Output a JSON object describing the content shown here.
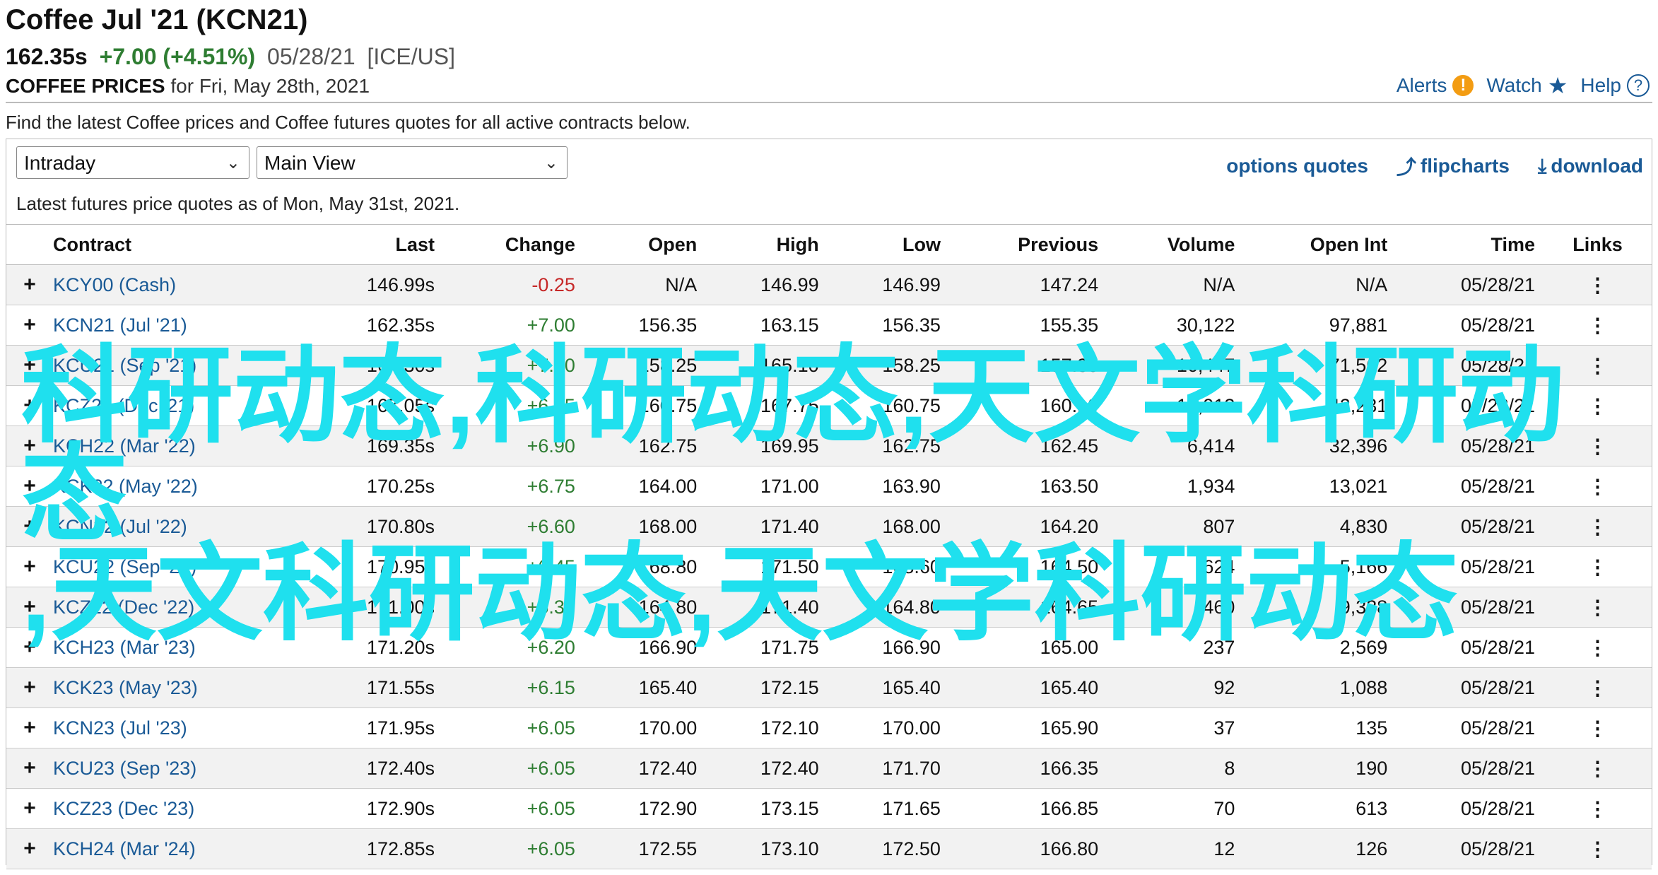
{
  "header": {
    "title": "Coffee Jul '21 (KCN21)",
    "price": "162.35s",
    "change": "+7.00 (+4.51%)",
    "date": "05/28/21",
    "exchange": "[ICE/US]",
    "section_label": "COFFEE PRICES",
    "section_date": "for Fri, May 28th, 2021"
  },
  "top_links": {
    "alerts": "Alerts",
    "watch": "Watch",
    "help": "Help"
  },
  "description": "Find the latest Coffee prices and Coffee futures quotes for all active contracts below.",
  "controls": {
    "period_select": "Intraday",
    "view_select": "Main View",
    "options_quotes": "options quotes",
    "flipcharts": "flipcharts",
    "download": "download"
  },
  "as_of": "Latest futures price quotes as of Mon, May 31st, 2021.",
  "table": {
    "headers": [
      "Contract",
      "Last",
      "Change",
      "Open",
      "High",
      "Low",
      "Previous",
      "Volume",
      "Open Int",
      "Time",
      "Links"
    ],
    "rows": [
      {
        "contract": "KCY00 (Cash)",
        "last": "146.99s",
        "change": "-0.25",
        "open": "N/A",
        "high": "146.99",
        "low": "146.99",
        "previous": "147.24",
        "volume": "N/A",
        "open_int": "N/A",
        "time": "05/28/21"
      },
      {
        "contract": "KCN21 (Jul '21)",
        "last": "162.35s",
        "change": "+7.00",
        "open": "156.35",
        "high": "163.15",
        "low": "156.35",
        "previous": "155.35",
        "volume": "30,122",
        "open_int": "97,881",
        "time": "05/28/21"
      },
      {
        "contract": "KCU21 (Sep '21)",
        "last": "164.30s",
        "change": "+7.00",
        "open": "158.25",
        "high": "165.10",
        "low": "158.25",
        "previous": "157.30",
        "volume": "16,447",
        "open_int": "71,562",
        "time": "05/28/21"
      },
      {
        "contract": "KCZ21 (Dec '21)",
        "last": "167.05s",
        "change": "+6.95",
        "open": "160.75",
        "high": "167.75",
        "low": "160.75",
        "previous": "160.10",
        "volume": "10,913",
        "open_int": "42,231",
        "time": "05/28/21"
      },
      {
        "contract": "KCH22 (Mar '22)",
        "last": "169.35s",
        "change": "+6.90",
        "open": "162.75",
        "high": "169.95",
        "low": "162.75",
        "previous": "162.45",
        "volume": "6,414",
        "open_int": "32,396",
        "time": "05/28/21"
      },
      {
        "contract": "KCK22 (May '22)",
        "last": "170.25s",
        "change": "+6.75",
        "open": "164.00",
        "high": "171.00",
        "low": "163.90",
        "previous": "163.50",
        "volume": "1,934",
        "open_int": "13,021",
        "time": "05/28/21"
      },
      {
        "contract": "KCN22 (Jul '22)",
        "last": "170.80s",
        "change": "+6.60",
        "open": "168.00",
        "high": "171.40",
        "low": "168.00",
        "previous": "164.20",
        "volume": "807",
        "open_int": "4,830",
        "time": "05/28/21"
      },
      {
        "contract": "KCU22 (Sep '22)",
        "last": "170.95s",
        "change": "+6.45",
        "open": "168.80",
        "high": "171.50",
        "low": "168.60",
        "previous": "164.50",
        "volume": "624",
        "open_int": "5,166",
        "time": "05/28/21"
      },
      {
        "contract": "KCZ22 (Dec '22)",
        "last": "171.00s",
        "change": "+6.35",
        "open": "164.80",
        "high": "171.40",
        "low": "164.80",
        "previous": "164.65",
        "volume": "460",
        "open_int": "9,338",
        "time": "05/28/21"
      },
      {
        "contract": "KCH23 (Mar '23)",
        "last": "171.20s",
        "change": "+6.20",
        "open": "166.90",
        "high": "171.75",
        "low": "166.90",
        "previous": "165.00",
        "volume": "237",
        "open_int": "2,569",
        "time": "05/28/21"
      },
      {
        "contract": "KCK23 (May '23)",
        "last": "171.55s",
        "change": "+6.15",
        "open": "165.40",
        "high": "172.15",
        "low": "165.40",
        "previous": "165.40",
        "volume": "92",
        "open_int": "1,088",
        "time": "05/28/21"
      },
      {
        "contract": "KCN23 (Jul '23)",
        "last": "171.95s",
        "change": "+6.05",
        "open": "170.00",
        "high": "172.10",
        "low": "170.00",
        "previous": "165.90",
        "volume": "37",
        "open_int": "135",
        "time": "05/28/21"
      },
      {
        "contract": "KCU23 (Sep '23)",
        "last": "172.40s",
        "change": "+6.05",
        "open": "172.40",
        "high": "172.40",
        "low": "171.70",
        "previous": "166.35",
        "volume": "8",
        "open_int": "190",
        "time": "05/28/21"
      },
      {
        "contract": "KCZ23 (Dec '23)",
        "last": "172.90s",
        "change": "+6.05",
        "open": "172.90",
        "high": "173.15",
        "low": "171.65",
        "previous": "166.85",
        "volume": "70",
        "open_int": "613",
        "time": "05/28/21"
      },
      {
        "contract": "KCH24 (Mar '24)",
        "last": "172.85s",
        "change": "+6.05",
        "open": "172.55",
        "high": "173.10",
        "low": "172.50",
        "previous": "166.80",
        "volume": "12",
        "open_int": "126",
        "time": "05/28/21"
      }
    ]
  },
  "watermark": {
    "line1": "科研动态,科研动态,天文学科研动态",
    "line2": ",天文科研动态,天文学科研动态"
  },
  "colors": {
    "link": "#1a5a96",
    "positive": "#2e7d32",
    "negative": "#c62828",
    "watermark": "#1fe0ee"
  }
}
